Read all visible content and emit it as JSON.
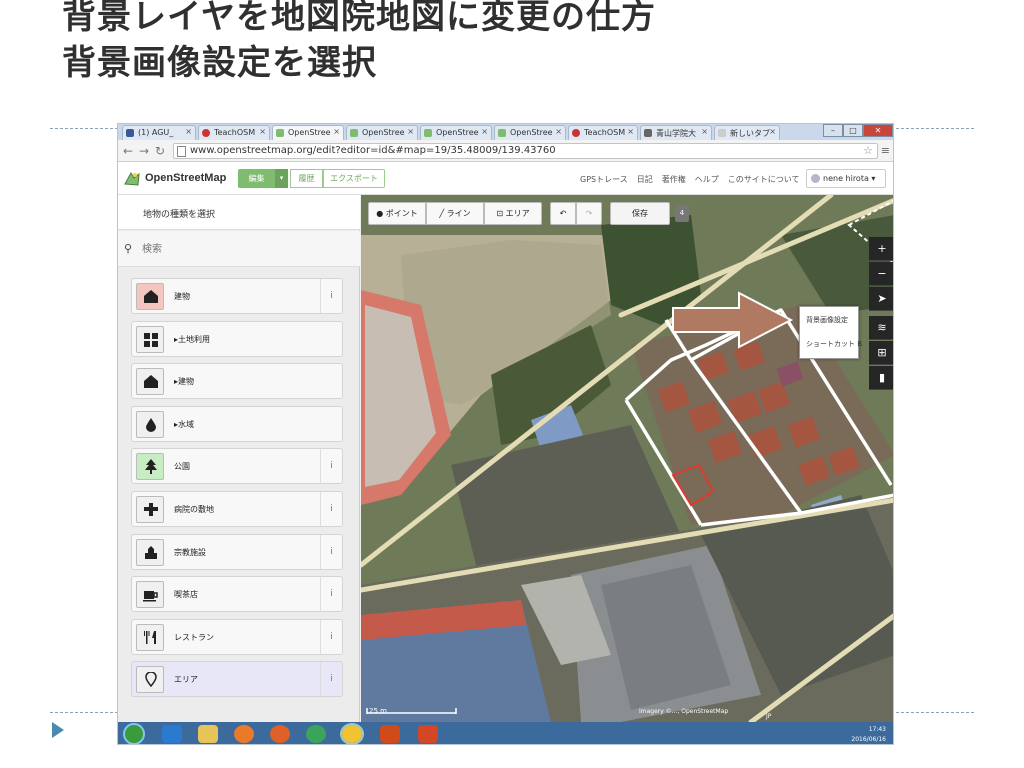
{
  "slide": {
    "title_line1": "背景レイヤを地図院地図に変更の仕方",
    "title_line2": "背景画像設定を選択"
  },
  "browser": {
    "tabs": [
      {
        "label": "(1) AGU_",
        "icon_color": "#3b5998",
        "active": false
      },
      {
        "label": "TeachOSM",
        "icon_color": "#cc3333",
        "active": false
      },
      {
        "label": "OpenStree",
        "icon_color": "#7ebc6f",
        "active": true
      },
      {
        "label": "OpenStree",
        "icon_color": "#7ebc6f",
        "active": false
      },
      {
        "label": "OpenStree",
        "icon_color": "#7ebc6f",
        "active": false
      },
      {
        "label": "OpenStree",
        "icon_color": "#7ebc6f",
        "active": false
      },
      {
        "label": "TeachOSM",
        "icon_color": "#cc3333",
        "active": false
      },
      {
        "label": "青山学院大",
        "icon_color": "#666666",
        "active": false
      },
      {
        "label": "新しいタブ",
        "icon_color": "#cccccc",
        "active": false
      }
    ],
    "url": "www.openstreetmap.org/edit?editor=id&#map=19/35.48009/139.43760"
  },
  "osm": {
    "brand": "OpenStreetMap",
    "edit_label": "編集",
    "history_label": "履歴",
    "export_label": "エクスポート",
    "links": [
      "GPSトレース",
      "日記",
      "著作権",
      "ヘルプ",
      "このサイトについて"
    ],
    "user": "nene hirota"
  },
  "sidebar": {
    "heading": "地物の種類を選択",
    "search_placeholder": "検索",
    "items": [
      {
        "label": "建物",
        "icon": "building-icon",
        "info": true,
        "tint": "#f3c6c0"
      },
      {
        "label": "▸土地利用",
        "icon": "landuse-icon",
        "info": false,
        "tint": "#f0f0f0"
      },
      {
        "label": "▸建物",
        "icon": "building-icon",
        "info": false,
        "tint": "#f0f0f0"
      },
      {
        "label": "▸水域",
        "icon": "water-drop-icon",
        "info": false,
        "tint": "#f0f0f0"
      },
      {
        "label": "公園",
        "icon": "tree-icon",
        "info": true,
        "tint": "#c8ecc4"
      },
      {
        "label": "病院の敷地",
        "icon": "hospital-cross-icon",
        "info": true,
        "tint": "#f0f0f0"
      },
      {
        "label": "宗教施設",
        "icon": "place-of-worship-icon",
        "info": true,
        "tint": "#f0f0f0"
      },
      {
        "label": "喫茶店",
        "icon": "cafe-cup-icon",
        "info": true,
        "tint": "#f0f0f0"
      },
      {
        "label": "レストラン",
        "icon": "restaurant-icon",
        "info": true,
        "tint": "#f0f0f0"
      },
      {
        "label": "エリア",
        "icon": "area-marker-icon",
        "info": true,
        "tint": "#f0f0f0"
      }
    ]
  },
  "map_toolbar": {
    "point": "ポイント",
    "line": "ライン",
    "area": "エリア",
    "save": "保存",
    "count": "4"
  },
  "popup": {
    "item1": "背景画像設定",
    "item2": "ショートカット B"
  },
  "map_footer": {
    "scale": "25 m",
    "attribution": "Imagery ©..., OpenStreetMap"
  },
  "taskbar": {
    "ime": "JP",
    "time": "17:43",
    "date": "2016/06/16"
  },
  "colors": {
    "osm_green": "#7ebc6f",
    "arrow_brown": "#b07a62",
    "selected_red": "#e03a2e"
  }
}
